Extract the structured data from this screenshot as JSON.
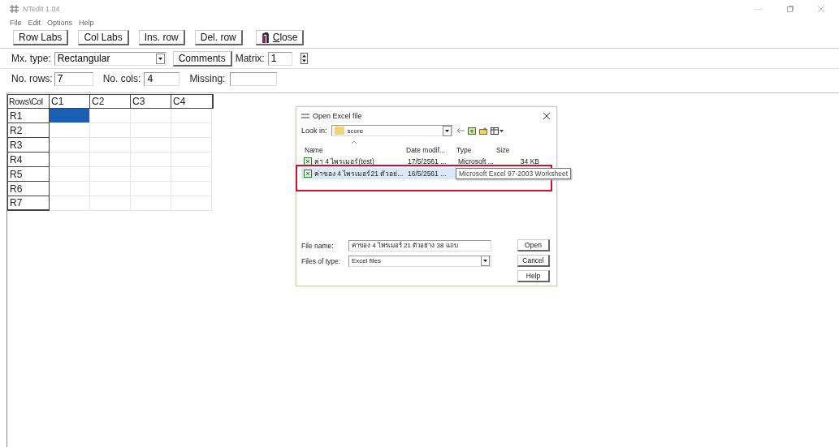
{
  "window": {
    "title": "NTedit 1.04"
  },
  "menu": [
    "File",
    "Edit",
    "Options",
    "Help"
  ],
  "toolbar": [
    "Row Labs",
    "Col Labs",
    "Ins. row",
    "Del. row",
    "Close"
  ],
  "matrix_settings": {
    "type_label": "Mx. type:",
    "type_value": "Rectangular",
    "comments_button": "Comments",
    "matrix_label": "Matrix:",
    "matrix_value": "1",
    "rows_label": "No. rows:",
    "rows_value": "7",
    "cols_label": "No. cols:",
    "cols_value": "4",
    "missing_label": "Missing:"
  },
  "grid": {
    "corner": "Rows\\Col",
    "columns": [
      "C1",
      "C2",
      "C3",
      "C4"
    ],
    "rows": [
      {
        "label": "R1",
        "cells": [
          {
            "selected": true
          },
          {
            "selected": false
          },
          {
            "selected": false
          },
          {
            "selected": false
          }
        ]
      },
      {
        "label": "R2",
        "cells": [
          {
            "selected": false
          },
          {
            "selected": false
          },
          {
            "selected": false
          },
          {
            "selected": false
          }
        ]
      },
      {
        "label": "R3",
        "cells": [
          {
            "selected": false
          },
          {
            "selected": false
          },
          {
            "selected": false
          },
          {
            "selected": false
          }
        ]
      },
      {
        "label": "R4",
        "cells": [
          {
            "selected": false
          },
          {
            "selected": false
          },
          {
            "selected": false
          },
          {
            "selected": false
          }
        ]
      },
      {
        "label": "R5",
        "cells": [
          {
            "selected": false
          },
          {
            "selected": false
          },
          {
            "selected": false
          },
          {
            "selected": false
          }
        ]
      },
      {
        "label": "R6",
        "cells": [
          {
            "selected": false
          },
          {
            "selected": false
          },
          {
            "selected": false
          },
          {
            "selected": false
          }
        ]
      },
      {
        "label": "R7",
        "cells": [
          {
            "selected": false
          },
          {
            "selected": false
          },
          {
            "selected": false
          },
          {
            "selected": false
          }
        ]
      }
    ]
  },
  "dialog": {
    "title": "Open Excel file",
    "look_in_label": "Look in:",
    "look_in_value": "score",
    "columns": [
      "Name",
      "Date modif...",
      "Type",
      "Size"
    ],
    "files": [
      {
        "name": "ค่า 4 ไพรเมอร์(test)",
        "date": "17/5/2561 ...",
        "type": "Microsoft ...",
        "size": "34 KB",
        "selected": false
      },
      {
        "name": "ค่าของ 4 ไพรเมอร์21 ตัวอย่...",
        "date": "16/5/2561 ...",
        "selected": true
      }
    ],
    "tooltip": "Microsoft Excel 97-2003 Worksheet",
    "file_name_label": "File name:",
    "file_name_value": "ค่าของ 4 ไพรเมอร์ 21 ตัวอย่าง 38 แถบ",
    "file_type_label": "Files of type:",
    "file_type_value": "Excel files",
    "buttons": [
      "Open",
      "Cancel",
      "Help"
    ]
  }
}
